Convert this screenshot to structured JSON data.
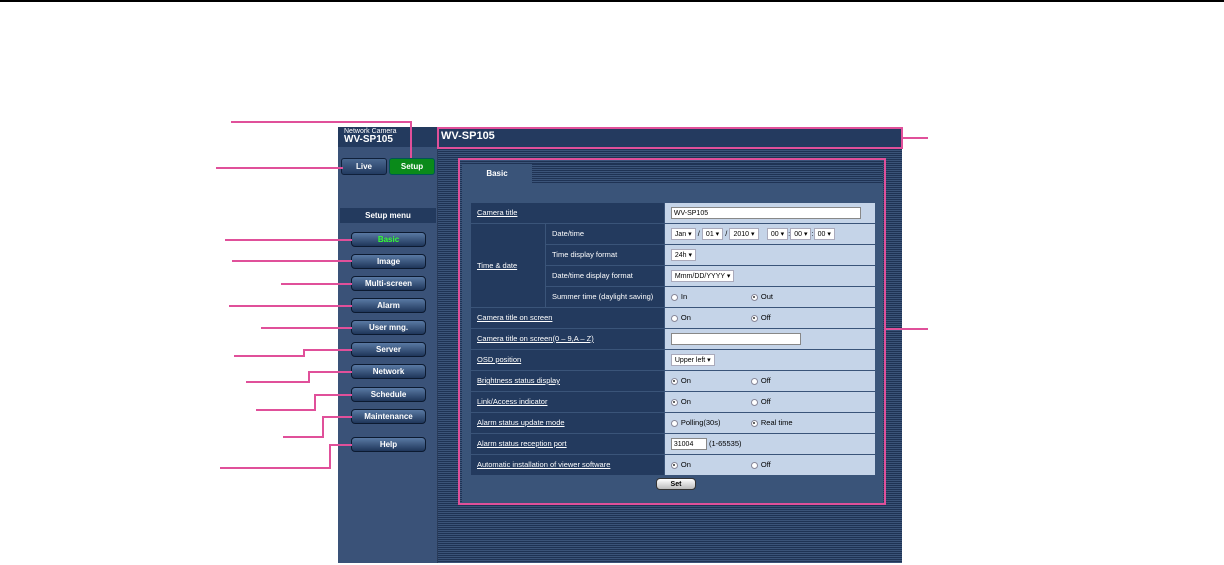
{
  "brand": {
    "subtitle": "Network Camera",
    "model": "WV-SP105"
  },
  "modes": {
    "live": "Live",
    "setup": "Setup"
  },
  "setup_menu": {
    "title": "Setup menu",
    "items": [
      "Basic",
      "Image",
      "Multi-screen",
      "Alarm",
      "User mng.",
      "Server",
      "Network",
      "Schedule",
      "Maintenance",
      "Help"
    ]
  },
  "header": {
    "title": "WV-SP105"
  },
  "tab": "Basic",
  "form": {
    "camera_title": {
      "label": "Camera title",
      "value": "WV-SP105"
    },
    "time_date": {
      "label": "Time & date",
      "datetime": {
        "label": "Date/time",
        "month": "Jan",
        "day": "01",
        "year": "2010",
        "hour": "00",
        "minute": "00",
        "second": "00",
        "sep1": "/",
        "sep2": "/",
        "sep3": ":",
        "sep4": ":"
      },
      "time_format": {
        "label": "Time display format",
        "value": "24h"
      },
      "date_format": {
        "label": "Date/time display format",
        "value": "Mmm/DD/YYYY"
      },
      "summer": {
        "label": "Summer time (daylight saving)",
        "opt1": "In",
        "opt2": "Out"
      }
    },
    "title_on_screen": {
      "label": "Camera title on screen",
      "opt1": "On",
      "opt2": "Off"
    },
    "title_on_screen_text": {
      "label": "Camera title on screen(0 – 9,A – Z)",
      "value": ""
    },
    "osd": {
      "label": "OSD position",
      "value": "Upper left"
    },
    "brightness": {
      "label": "Brightness status display",
      "opt1": "On",
      "opt2": "Off"
    },
    "link": {
      "label": "Link/Access indicator",
      "opt1": "On",
      "opt2": "Off"
    },
    "alarm_mode": {
      "label": "Alarm status update mode",
      "opt1": "Polling(30s)",
      "opt2": "Real time"
    },
    "alarm_port": {
      "label": "Alarm status reception port",
      "value": "31004",
      "range": "(1-65535)"
    },
    "auto_install": {
      "label": "Automatic installation of viewer software",
      "opt1": "On",
      "opt2": "Off"
    },
    "set": "Set"
  },
  "colors": {
    "callout": "#e0509a",
    "accent_green": "#0a8a1a"
  }
}
